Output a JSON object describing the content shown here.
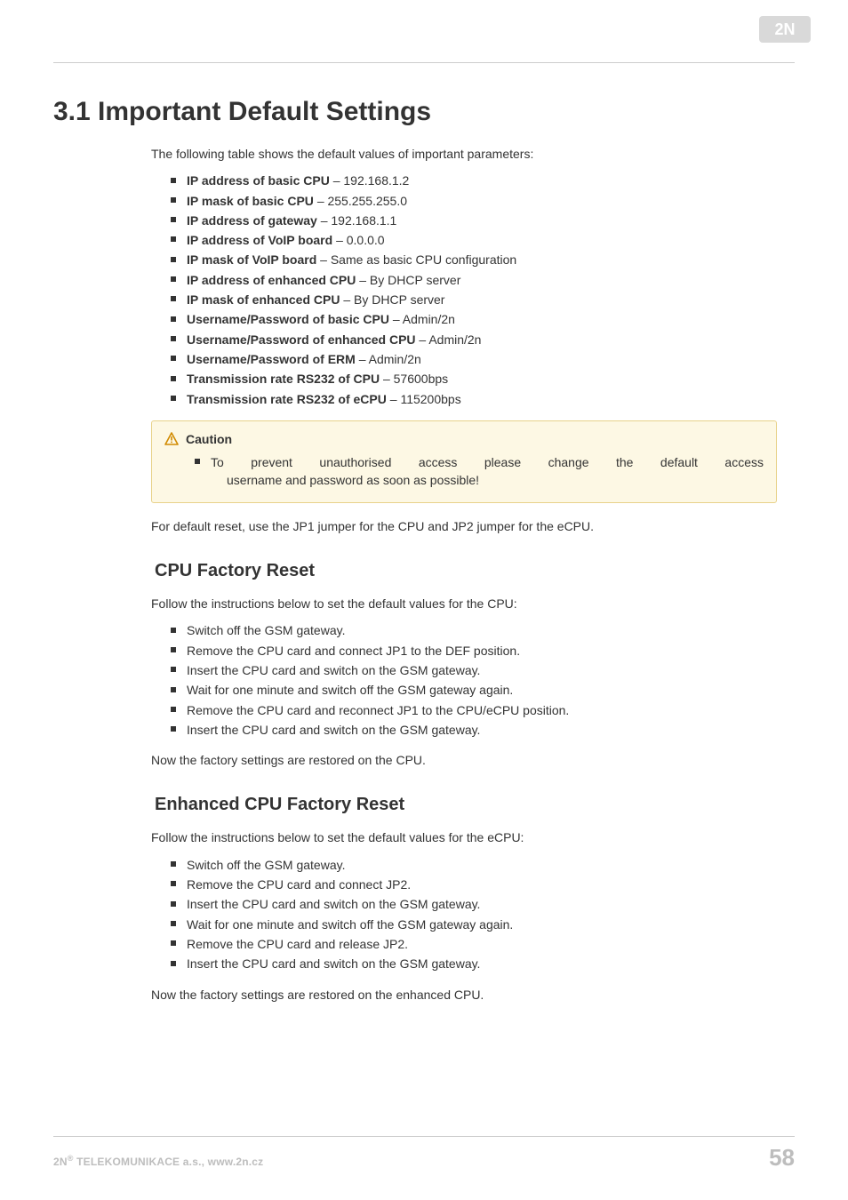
{
  "logo": {
    "name": "2N"
  },
  "title": "3.1 Important Default Settings",
  "intro": "The following table shows the default values of important parameters:",
  "defaults": [
    {
      "label": "IP address of basic CPU ",
      "value": "– 192.168.1.2"
    },
    {
      "label": "IP mask of basic CPU ",
      "value": "– 255.255.255.0"
    },
    {
      "label": "IP address of gateway ",
      "value": "– 192.168.1.1"
    },
    {
      "label": "IP address of VoIP board ",
      "value": "– 0.0.0.0"
    },
    {
      "label": "IP mask of VoIP board ",
      "value": "– Same as basic CPU configuration"
    },
    {
      "label": "IP address of enhanced CPU ",
      "value": "– By DHCP server"
    },
    {
      "label": "IP mask of enhanced CPU ",
      "value": "– By DHCP server"
    },
    {
      "label": "Username/Password of basic CPU ",
      "value": "– Admin/2n"
    },
    {
      "label": "Username/Password of enhanced CPU ",
      "value": "– Admin/2n"
    },
    {
      "label": "Username/Password of ERM ",
      "value": "– Admin/2n"
    },
    {
      "label": "Transmission rate RS232 of CPU ",
      "value": "– 57600bps"
    },
    {
      "label": "Transmission rate RS232 of eCPU ",
      "value": "– 115200bps"
    }
  ],
  "caution": {
    "title": "Caution",
    "line1": "To prevent unauthorised access please change the default access",
    "line2": "username and password as soon as possible!"
  },
  "reset_note": "For default reset, use the JP1 jumper for the CPU and JP2 jumper for the eCPU.",
  "cpu_section": {
    "heading": "CPU Factory Reset",
    "intro": "Follow the instructions below to set the default values for the CPU:",
    "steps": [
      "Switch off the GSM gateway.",
      "Remove the CPU card and connect JP1 to the DEF position.",
      "Insert the CPU card and switch on the GSM gateway.",
      "Wait for one minute and switch off the GSM gateway again.",
      "Remove the CPU card and reconnect JP1 to the CPU/eCPU position.",
      "Insert the CPU card and switch on the GSM gateway."
    ],
    "outro": "Now the factory settings are restored on the CPU."
  },
  "ecpu_section": {
    "heading": "Enhanced CPU Factory Reset",
    "intro": "Follow the instructions below to set the default values for the eCPU:",
    "steps": [
      "Switch off the GSM gateway.",
      "Remove the CPU card and connect JP2.",
      "Insert the CPU card and switch on the GSM gateway.",
      "Wait for one minute and switch off the GSM gateway again.",
      "Remove the CPU card and release JP2.",
      "Insert the CPU card and switch on the GSM gateway."
    ],
    "outro": "Now the factory settings are restored on the enhanced CPU."
  },
  "footer": {
    "company_prefix": "2N",
    "company_sup": "®",
    "company_rest": " TELEKOMUNIKACE a.s., www.2n.cz",
    "page": "58"
  }
}
